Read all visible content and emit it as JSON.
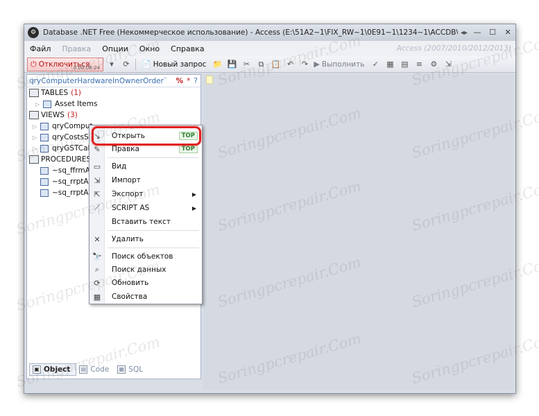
{
  "window": {
    "title": "Database .NET Free (Некоммерческое использование) - Access (E:\\51A2~1\\FIX_RW~1\\0E91~1\\1234~1\\ACCDB\\...",
    "title_arrows": "◂▸",
    "minimize": "—",
    "maximize": "☐",
    "close": "✕"
  },
  "menubar": {
    "items": [
      "Файл",
      "Правка",
      "Опции",
      "Окно",
      "Справка"
    ],
    "disabled_index": 1,
    "version_text": "Access (2007/2010/2012/2013)"
  },
  "toolbar": {
    "disconnect_label": "Отключиться",
    "disconnect_timer": "0.00:06:24",
    "new_query_label": "Новый запрос",
    "execute_label": "Выполнить"
  },
  "panel": {
    "query_name": "qryComputerHardwareInOwnerOrder`",
    "pct": "%",
    "star": "*",
    "help": "?",
    "tree": [
      {
        "type": "category",
        "label": "TABLES",
        "count": "(1)"
      },
      {
        "type": "item",
        "label": "Asset Items"
      },
      {
        "type": "category",
        "label": "VIEWS",
        "count": "(3)"
      },
      {
        "type": "item",
        "label": "qryComput"
      },
      {
        "type": "item",
        "label": "qryCostsSu"
      },
      {
        "type": "item",
        "label": "qryGSTCalc"
      },
      {
        "type": "category",
        "label": "PROCEDURES",
        "count": ""
      },
      {
        "type": "leaf",
        "label": "~sq_ffrmA"
      },
      {
        "type": "leaf",
        "label": "~sq_rrptAs"
      },
      {
        "type": "leaf",
        "label": "~sq_rrptAs"
      }
    ],
    "tabs": [
      "Object",
      "Code",
      "SQL"
    ]
  },
  "context_menu": {
    "items": [
      {
        "label": "Открыть",
        "badge": "TOP",
        "icon": "open-icon"
      },
      {
        "label": "Правка",
        "badge": "TOP",
        "icon": "edit-icon"
      },
      {
        "label": "Вид",
        "icon": "view-icon"
      },
      {
        "label": "Импорт",
        "icon": "import-icon"
      },
      {
        "label": "Экспорт",
        "submenu": true,
        "icon": "export-icon"
      },
      {
        "label": "SCRIPT AS",
        "submenu": true,
        "icon": "script-icon"
      },
      {
        "label": "Вставить текст",
        "icon": "paste-text-icon"
      },
      {
        "label": "Удалить",
        "icon": "delete-icon"
      },
      {
        "label": "Поиск объектов",
        "icon": "find-objects-icon"
      },
      {
        "label": "Поиск данных",
        "icon": "find-data-icon"
      },
      {
        "label": "Обновить",
        "icon": "refresh-icon"
      },
      {
        "label": "Свойства",
        "icon": "properties-icon"
      }
    ]
  },
  "watermark": "Soringpcrepair.Com",
  "colors": {
    "highlight": "#e02020",
    "disconnect_bg": "#f6c9c9",
    "link_blue": "#3a6fb0"
  }
}
